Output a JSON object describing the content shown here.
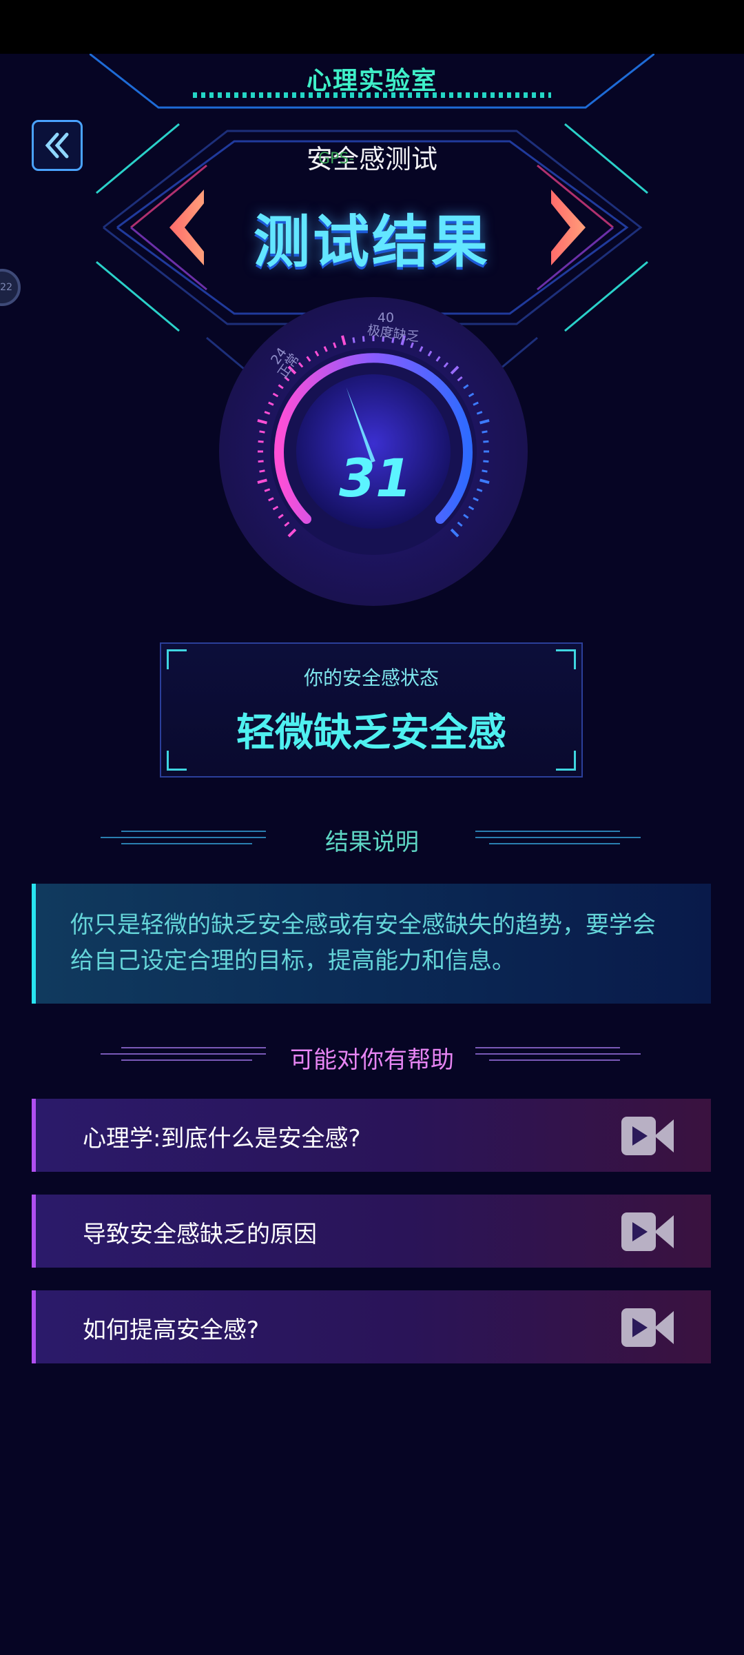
{
  "header": {
    "title": "心理实验室",
    "test_name": "安全感测试",
    "overlay_badge": "GPS-"
  },
  "side_bubble": {
    "text": "22"
  },
  "result": {
    "title": "测试结果"
  },
  "gauge": {
    "score": "31",
    "value": 31,
    "ticks": [
      {
        "value": "24",
        "label": "正常"
      },
      {
        "value": "40",
        "label": "极度缺乏"
      }
    ]
  },
  "status": {
    "label": "你的安全感状态",
    "value": "轻微缺乏安全感"
  },
  "explain": {
    "title": "结果说明",
    "text": "你只是轻微的缺乏安全感或有安全感缺失的趋势，要学会给自己设定合理的目标，提高能力和信息。"
  },
  "help": {
    "title": "可能对你有帮助",
    "items": [
      {
        "label": "心理学:到底什么是安全感?"
      },
      {
        "label": "导致安全感缺乏的原因"
      },
      {
        "label": "如何提高安全感?"
      }
    ]
  },
  "colors": {
    "accent_cyan": "#4ff0f0",
    "accent_purple": "#b04ff0",
    "background": "#060524"
  }
}
